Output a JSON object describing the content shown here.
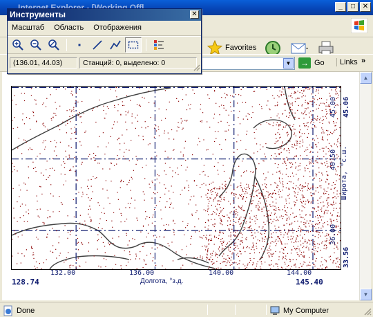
{
  "browser": {
    "title": "Internet Explorer - [Working Offl",
    "favorites_label": "Favorites",
    "address_value": "m",
    "go_label": "Go",
    "links_label": "Links",
    "status_done": "Done",
    "status_zone": "My Computer"
  },
  "tool_window": {
    "title": "Инструменты",
    "menu": [
      "Масштаб",
      "Область",
      "Отображения"
    ],
    "status_coords": "(136.01, 44.03)",
    "status_stations": "Станций: 0, выделено: 0"
  },
  "map": {
    "lon_min": "128.74",
    "lon_max": "145.40",
    "lon_ticks": [
      "132.00",
      "136.00",
      "140.00",
      "144.00"
    ],
    "lon_label": "Долгота, °з.д.",
    "lat_min": "33.56",
    "lat_max": "45.06",
    "lat_ticks": [
      "36.00",
      "40.50",
      "45.00"
    ],
    "lat_label": "Широта, °с.ш.",
    "point_color": "#8b0000",
    "grid_color": "#0d1a6e"
  }
}
